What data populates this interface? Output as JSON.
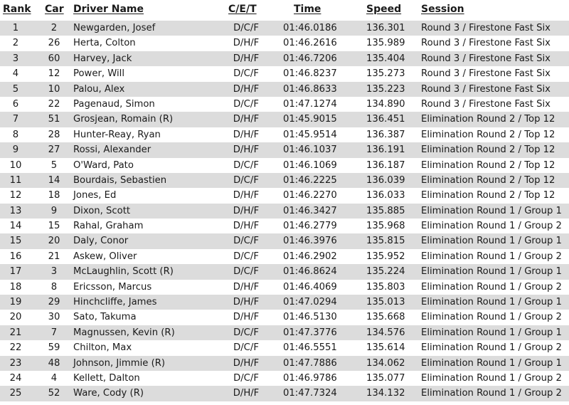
{
  "table": {
    "headers": {
      "rank": "Rank",
      "car": "Car",
      "driver": "Driver Name",
      "cet": "C/E/T",
      "time": "Time",
      "speed": "Speed",
      "session": "Session"
    },
    "row_shade_color": "#dcdcdc",
    "rows": [
      {
        "rank": "1",
        "car": "2",
        "driver": "Newgarden, Josef",
        "cet": "D/C/F",
        "time": "01:46.0186",
        "speed": "136.301",
        "session": "Round 3 / Firestone Fast Six"
      },
      {
        "rank": "2",
        "car": "26",
        "driver": "Herta, Colton",
        "cet": "D/H/F",
        "time": "01:46.2616",
        "speed": "135.989",
        "session": "Round 3 / Firestone Fast Six"
      },
      {
        "rank": "3",
        "car": "60",
        "driver": "Harvey, Jack",
        "cet": "D/H/F",
        "time": "01:46.7206",
        "speed": "135.404",
        "session": "Round 3 / Firestone Fast Six"
      },
      {
        "rank": "4",
        "car": "12",
        "driver": "Power, Will",
        "cet": "D/C/F",
        "time": "01:46.8237",
        "speed": "135.273",
        "session": "Round 3 / Firestone Fast Six"
      },
      {
        "rank": "5",
        "car": "10",
        "driver": "Palou, Alex",
        "cet": "D/H/F",
        "time": "01:46.8633",
        "speed": "135.223",
        "session": "Round 3 / Firestone Fast Six"
      },
      {
        "rank": "6",
        "car": "22",
        "driver": "Pagenaud, Simon",
        "cet": "D/C/F",
        "time": "01:47.1274",
        "speed": "134.890",
        "session": "Round 3 / Firestone Fast Six"
      },
      {
        "rank": "7",
        "car": "51",
        "driver": "Grosjean, Romain (R)",
        "cet": "D/H/F",
        "time": "01:45.9015",
        "speed": "136.451",
        "session": "Elimination Round 2 / Top 12"
      },
      {
        "rank": "8",
        "car": "28",
        "driver": "Hunter-Reay, Ryan",
        "cet": "D/H/F",
        "time": "01:45.9514",
        "speed": "136.387",
        "session": "Elimination Round 2 / Top 12"
      },
      {
        "rank": "9",
        "car": "27",
        "driver": "Rossi, Alexander",
        "cet": "D/H/F",
        "time": "01:46.1037",
        "speed": "136.191",
        "session": "Elimination Round 2 / Top 12"
      },
      {
        "rank": "10",
        "car": "5",
        "driver": "O'Ward, Pato",
        "cet": "D/C/F",
        "time": "01:46.1069",
        "speed": "136.187",
        "session": "Elimination Round 2 / Top 12"
      },
      {
        "rank": "11",
        "car": "14",
        "driver": "Bourdais, Sebastien",
        "cet": "D/C/F",
        "time": "01:46.2225",
        "speed": "136.039",
        "session": "Elimination Round 2 / Top 12"
      },
      {
        "rank": "12",
        "car": "18",
        "driver": "Jones, Ed",
        "cet": "D/H/F",
        "time": "01:46.2270",
        "speed": "136.033",
        "session": "Elimination Round 2 / Top 12"
      },
      {
        "rank": "13",
        "car": "9",
        "driver": "Dixon, Scott",
        "cet": "D/H/F",
        "time": "01:46.3427",
        "speed": "135.885",
        "session": "Elimination Round 1 / Group 1"
      },
      {
        "rank": "14",
        "car": "15",
        "driver": "Rahal, Graham",
        "cet": "D/H/F",
        "time": "01:46.2779",
        "speed": "135.968",
        "session": "Elimination Round 1 / Group 2"
      },
      {
        "rank": "15",
        "car": "20",
        "driver": "Daly, Conor",
        "cet": "D/C/F",
        "time": "01:46.3976",
        "speed": "135.815",
        "session": "Elimination Round 1 / Group 1"
      },
      {
        "rank": "16",
        "car": "21",
        "driver": "Askew, Oliver",
        "cet": "D/C/F",
        "time": "01:46.2902",
        "speed": "135.952",
        "session": "Elimination Round 1 / Group 2"
      },
      {
        "rank": "17",
        "car": "3",
        "driver": "McLaughlin, Scott (R)",
        "cet": "D/C/F",
        "time": "01:46.8624",
        "speed": "135.224",
        "session": "Elimination Round 1 / Group 1"
      },
      {
        "rank": "18",
        "car": "8",
        "driver": "Ericsson, Marcus",
        "cet": "D/H/F",
        "time": "01:46.4069",
        "speed": "135.803",
        "session": "Elimination Round 1 / Group 2"
      },
      {
        "rank": "19",
        "car": "29",
        "driver": "Hinchcliffe, James",
        "cet": "D/H/F",
        "time": "01:47.0294",
        "speed": "135.013",
        "session": "Elimination Round 1 / Group 1"
      },
      {
        "rank": "20",
        "car": "30",
        "driver": "Sato, Takuma",
        "cet": "D/H/F",
        "time": "01:46.5130",
        "speed": "135.668",
        "session": "Elimination Round 1 / Group 2"
      },
      {
        "rank": "21",
        "car": "7",
        "driver": "Magnussen, Kevin (R)",
        "cet": "D/C/F",
        "time": "01:47.3776",
        "speed": "134.576",
        "session": "Elimination Round 1 / Group 1"
      },
      {
        "rank": "22",
        "car": "59",
        "driver": "Chilton, Max",
        "cet": "D/C/F",
        "time": "01:46.5551",
        "speed": "135.614",
        "session": "Elimination Round 1 / Group 2"
      },
      {
        "rank": "23",
        "car": "48",
        "driver": "Johnson, Jimmie (R)",
        "cet": "D/H/F",
        "time": "01:47.7886",
        "speed": "134.062",
        "session": "Elimination Round 1 / Group 1"
      },
      {
        "rank": "24",
        "car": "4",
        "driver": "Kellett, Dalton",
        "cet": "D/C/F",
        "time": "01:46.9786",
        "speed": "135.077",
        "session": "Elimination Round 1 / Group 2"
      },
      {
        "rank": "25",
        "car": "52",
        "driver": "Ware, Cody (R)",
        "cet": "D/H/F",
        "time": "01:47.7324",
        "speed": "134.132",
        "session": "Elimination Round 1 / Group 2"
      }
    ]
  }
}
